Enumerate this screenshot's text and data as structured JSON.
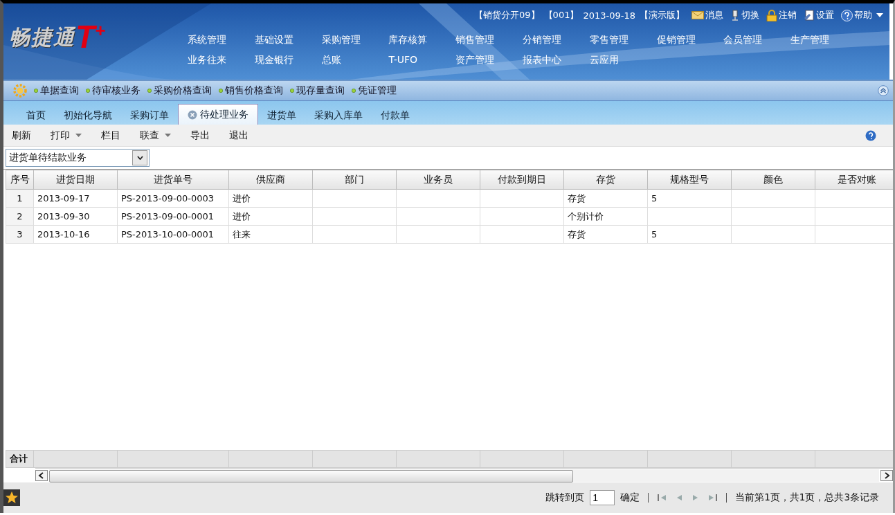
{
  "header": {
    "logo_text": "畅捷通",
    "logo_mark": "T$^{+}$",
    "info": [
      "【销货分开09】",
      "【001】",
      "2013-09-18",
      "【演示版】"
    ],
    "actions": [
      {
        "kind": "mail",
        "label": "消息"
      },
      {
        "kind": "switch",
        "label": "切换"
      },
      {
        "kind": "lock",
        "label": "注销"
      },
      {
        "kind": "settings",
        "label": "设置"
      },
      {
        "kind": "help",
        "label": "帮助"
      }
    ],
    "menu_rows": [
      [
        "系统管理",
        "基础设置",
        "采购管理",
        "库存核算",
        "销售管理",
        "分销管理",
        "零售管理",
        "促销管理",
        "会员管理",
        "生产管理"
      ],
      [
        "业务往来",
        "现金银行",
        "总账",
        "T-UFO",
        "资产管理",
        "报表中心",
        "云应用"
      ]
    ]
  },
  "quick_links": [
    "单据查询",
    "待审核业务",
    "采购价格查询",
    "销售价格查询",
    "现存量查询",
    "凭证管理"
  ],
  "tabs": [
    {
      "label": "首页",
      "selected": false,
      "closable": false
    },
    {
      "label": "初始化导航",
      "selected": false,
      "closable": false
    },
    {
      "label": "采购订单",
      "selected": false,
      "closable": false
    },
    {
      "label": "待处理业务",
      "selected": true,
      "closable": true
    },
    {
      "label": "进货单",
      "selected": false,
      "closable": false
    },
    {
      "label": "采购入库单",
      "selected": false,
      "closable": false
    },
    {
      "label": "付款单",
      "selected": false,
      "closable": false
    }
  ],
  "toolbar": [
    {
      "label": "刷新",
      "dropdown": false
    },
    {
      "label": "打印",
      "dropdown": true
    },
    {
      "label": "栏目",
      "dropdown": false
    },
    {
      "label": "联查",
      "dropdown": true
    },
    {
      "label": "导出",
      "dropdown": false
    },
    {
      "label": "退出",
      "dropdown": false
    }
  ],
  "filter": {
    "value": "进货单待结款业务"
  },
  "table": {
    "columns": [
      "序号",
      "进货日期",
      "进货单号",
      "供应商",
      "部门",
      "业务员",
      "付款到期日",
      "存货",
      "规格型号",
      "颜色",
      "是否对账"
    ],
    "rows": [
      [
        "1",
        "2013-09-17",
        "PS-2013-09-00-0003",
        "进价",
        "",
        "",
        "",
        "存货",
        "5",
        "",
        ""
      ],
      [
        "2",
        "2013-09-30",
        "PS-2013-09-00-0001",
        "进价",
        "",
        "",
        "",
        "个别计价",
        "",
        "",
        ""
      ],
      [
        "3",
        "2013-10-16",
        "PS-2013-10-00-0001",
        "往来",
        "",
        "",
        "",
        "存货",
        "5",
        "",
        ""
      ]
    ],
    "total_label": "合计"
  },
  "pager": {
    "jump_label": "跳转到页",
    "page_value": "1",
    "confirm": "确定",
    "summary": "当前第1页，共1页，总共3条记录"
  }
}
